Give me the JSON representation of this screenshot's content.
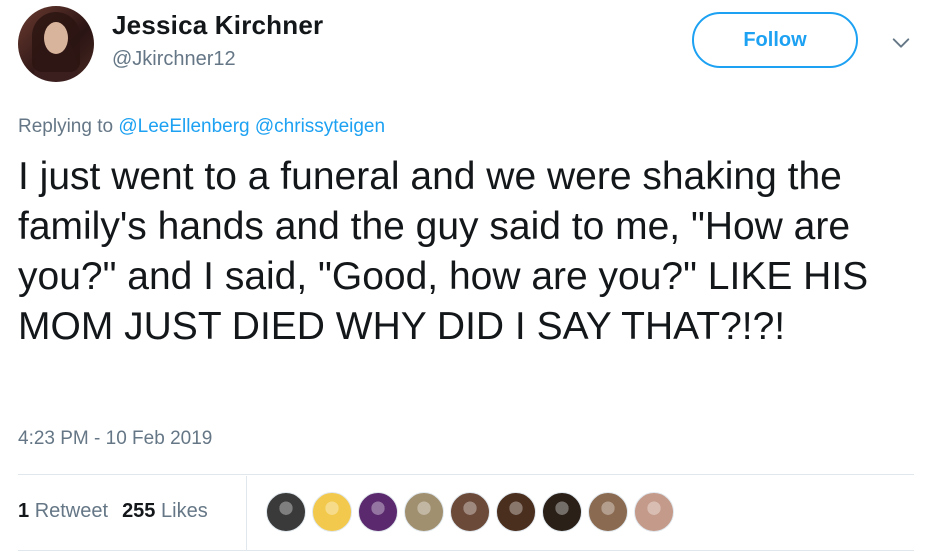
{
  "user": {
    "display_name": "Jessica Kirchner",
    "handle": "@Jkirchner12"
  },
  "follow_label": "Follow",
  "reply": {
    "prefix": "Replying to",
    "mentions": [
      "@LeeEllenberg",
      "@chrissyteigen"
    ]
  },
  "tweet_text": "I just went to a funeral and we were shaking the family's hands and the guy said to me, \"How are you?\" and I said, \"Good, how are you?\" LIKE HIS MOM JUST DIED WHY DID I SAY THAT?!?!",
  "timestamp": "4:23 PM - 10 Feb 2019",
  "stats": {
    "retweets_count": "1",
    "retweets_label": "Retweet",
    "likes_count": "255",
    "likes_label": "Likes"
  },
  "icons": {
    "menu": "chevron-down-icon"
  },
  "colors": {
    "accent": "#1da1f2",
    "secondary_text": "#657786",
    "primary_text": "#14171a",
    "divider": "#e1e8ed"
  },
  "likers": [
    {
      "color": "#3a3a3a"
    },
    {
      "color": "#f2c94c"
    },
    {
      "color": "#5b2a6e"
    },
    {
      "color": "#a09070"
    },
    {
      "color": "#6b4a3a"
    },
    {
      "color": "#4a2e1e"
    },
    {
      "color": "#2a2018"
    },
    {
      "color": "#8a6a50"
    },
    {
      "color": "#c49a8a"
    }
  ]
}
